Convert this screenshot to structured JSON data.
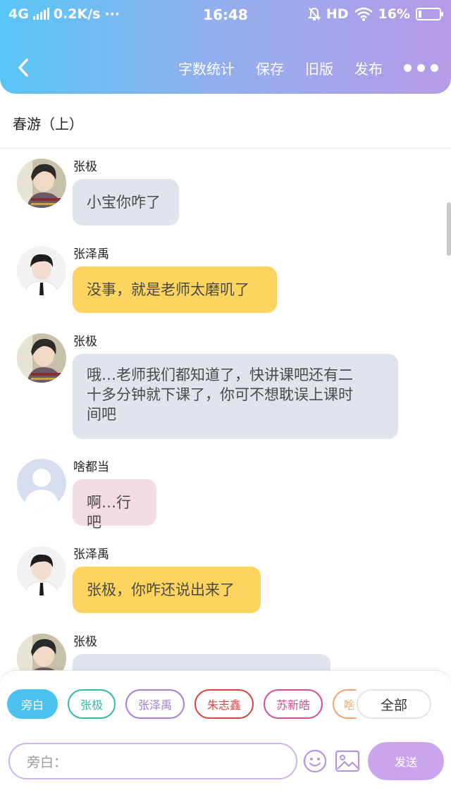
{
  "status_bar": {
    "network": "4G",
    "speed": "0.2K/s",
    "dots": "···",
    "time": "16:48",
    "hd": "HD",
    "battery": "16%",
    "battery_level": 0.16
  },
  "navbar": {
    "actions": [
      "字数统计",
      "保存",
      "旧版",
      "发布"
    ]
  },
  "story": {
    "title": "春游（上）"
  },
  "messages": [
    {
      "sender": "张极",
      "text": "小宝你咋了",
      "style": "gray",
      "avatar": "boy-photo-avatar"
    },
    {
      "sender": "张泽禹",
      "text": "没事，就是老师太磨叽了",
      "style": "yellow",
      "avatar": "boy-suit-avatar"
    },
    {
      "sender": "张极",
      "text": "哦…老师我们都知道了，快讲课吧还有二十多分钟就下课了，你可不想耽误上课时间吧",
      "lines": [
        "哦…老师我们都知道了，快讲课吧还有二",
        "十多分钟就下课了，你可不想耽误上课时",
        "间吧"
      ],
      "style": "gray",
      "avatar": "boy-photo-avatar"
    },
    {
      "sender": "啥都当",
      "text": "啊…行吧",
      "style": "pink",
      "avatar": "default-user-avatar"
    },
    {
      "sender": "张泽禹",
      "text": "张极，你咋还说出来了",
      "style": "yellow",
      "avatar": "boy-suit-avatar"
    },
    {
      "sender": "张极",
      "text": "",
      "style": "gray",
      "avatar": "boy-photo-avatar"
    }
  ],
  "characters": [
    {
      "label": "旁白",
      "color": "#4cc3ef",
      "active": true
    },
    {
      "label": "张极",
      "color": "#34b9a6"
    },
    {
      "label": "张泽禹",
      "color": "#a77fd6"
    },
    {
      "label": "朱志鑫",
      "color": "#d8453e"
    },
    {
      "label": "苏新皓",
      "color": "#d24f96"
    },
    {
      "label": "啥",
      "color": "#f2a36b"
    }
  ],
  "all_label": "全部",
  "composer": {
    "placeholder": "旁白：",
    "send_label": "发送"
  }
}
